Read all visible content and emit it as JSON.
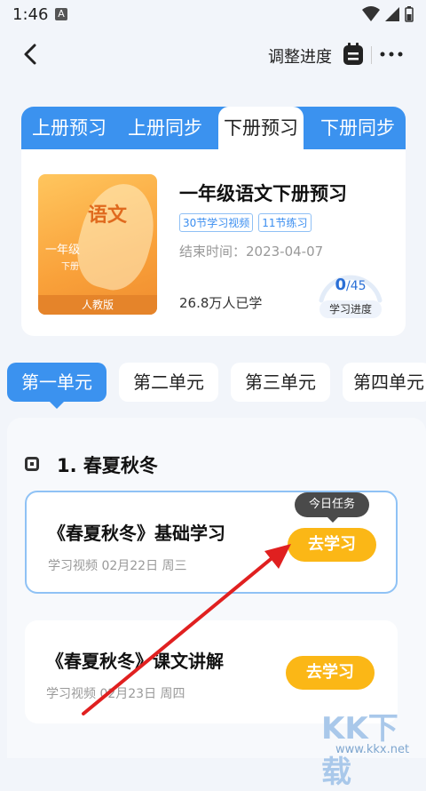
{
  "status": {
    "time": "1:46",
    "notification_letter": "A"
  },
  "header": {
    "adjust_label": "调整进度"
  },
  "tabs": [
    {
      "label": "上册预习"
    },
    {
      "label": "上册同步"
    },
    {
      "label": "下册预习"
    },
    {
      "label": "下册同步"
    }
  ],
  "book": {
    "cover_subject": "语文",
    "cover_grade": "一年级",
    "cover_volume": "下册",
    "cover_edition": "人教版",
    "title": "一年级语文下册预习",
    "badges": [
      "30节学习视频",
      "11节练习"
    ],
    "end_date": "结束时间：2023-04-07",
    "learners": "26.8万人已学",
    "progress_done": "0",
    "progress_total": "/45",
    "progress_label": "学习进度"
  },
  "units": [
    {
      "label": "第一单元"
    },
    {
      "label": "第二单元"
    },
    {
      "label": "第三单元"
    },
    {
      "label": "第四单元"
    }
  ],
  "section": {
    "title": "1. 春夏秋冬"
  },
  "tooltip": "今日任务",
  "lessons": [
    {
      "title": "《春夏秋冬》基础学习",
      "meta": "学习视频  02月22日  周三",
      "button": "去学习"
    },
    {
      "title": "《春夏秋冬》课文讲解",
      "meta": "学习视频  02月23日  周四",
      "button": "去学习"
    }
  ],
  "watermark": {
    "text": "KK下载",
    "url": "www.kkx.net"
  },
  "colors": {
    "primary": "#3b92ef",
    "accent": "#fbb716",
    "annotation_arrow": "#e02020"
  }
}
